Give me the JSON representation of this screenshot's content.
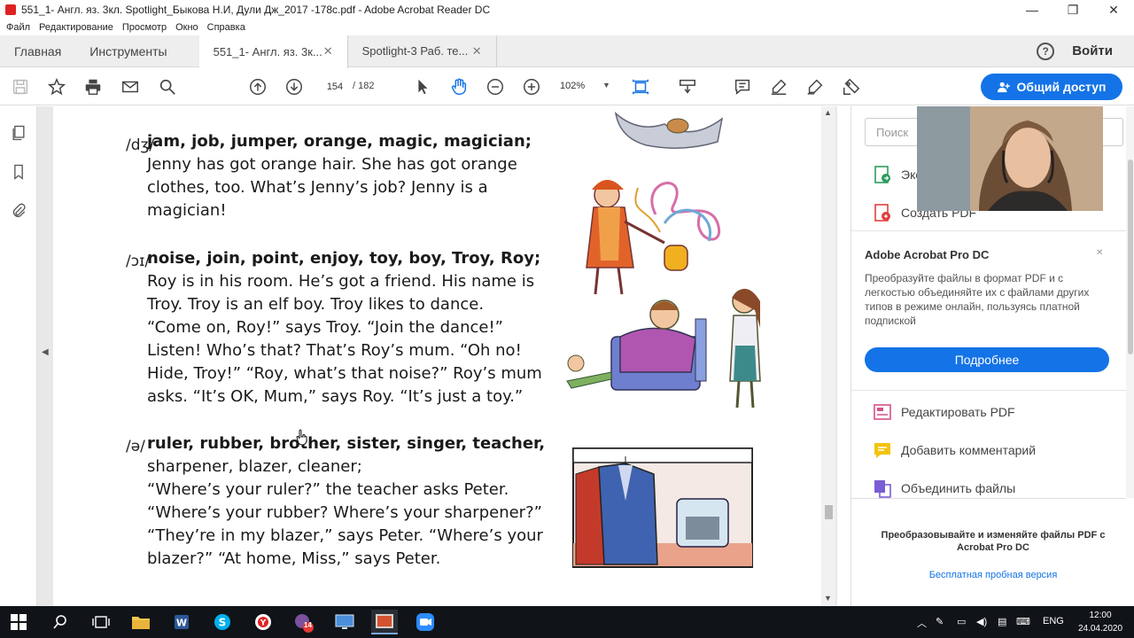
{
  "window": {
    "title": "551_1- Англ. яз. 3кл. Spotlight_Быкова Н.И, Дули Дж_2017 -178с.pdf - Adobe Acrobat Reader DC",
    "minimize": "—",
    "restore": "❐",
    "close": "✕"
  },
  "menu": [
    "Файл",
    "Редактирование",
    "Просмотр",
    "Окно",
    "Справка"
  ],
  "tabs": {
    "home": "Главная",
    "tools": "Инструменты",
    "doc1": "551_1- Англ. яз. 3к...",
    "doc2": "Spotlight-3 Раб. те...",
    "close_glyph": "✕",
    "help": "?",
    "signin": "Войти"
  },
  "toolbar": {
    "page_current": "154",
    "page_total": "/  182",
    "zoom": "102%",
    "share_label": "Общий доступ"
  },
  "document": {
    "sections": [
      {
        "pron": "/dʒ/",
        "words": "jam, job, jumper, orange, magic, magician;",
        "lines": [
          "Jenny has got orange hair. She has got orange",
          "clothes, too. What’s Jenny’s job? Jenny is a",
          "magician!"
        ]
      },
      {
        "pron": "/ɔɪ/",
        "words": "noise, join, point, enjoy, toy, boy, Troy, Roy;",
        "lines": [
          "Roy is in his room. He’s got a friend. His name is",
          "Troy. Troy is an elf boy. Troy likes to dance.",
          "“Come on, Roy!” says Troy. “Join the dance!”",
          "Listen! Who’s that? That’s Roy’s mum. “Oh no!",
          "Hide, Troy!” “Roy, what’s that noise?” Roy’s mum",
          "asks. “It’s OK, Mum,” says Roy. “It’s just a toy.”"
        ]
      },
      {
        "pron": "/ə/",
        "words": "ruler, rubber, brother, sister, singer, teacher,",
        "lines": [
          "sharpener, blazer, cleaner;",
          "“Where’s your ruler?” the teacher asks Peter.",
          "“Where’s your rubber? Where’s your sharpener?”",
          "“They’re in my blazer,” says Peter. “Where’s your",
          "blazer?” “At home, Miss,” says Peter."
        ]
      }
    ]
  },
  "right_panel": {
    "search_placeholder": "Поиск",
    "export_pdf": "Экспорт PDF",
    "create_pdf": "Создать PDF",
    "promo_title": "Adobe Acrobat Pro DC",
    "promo_text": "Преобразуйте файлы в формат PDF и с легкостью объединяйте их с файлами других типов в режиме онлайн, пользуясь платной подпиской",
    "promo_button": "Подробнее",
    "edit_pdf": "Редактировать PDF",
    "add_comment": "Добавить комментарий",
    "combine_files": "Объединить файлы",
    "bottom_title": "Преобразовывайте и изменяйте файлы PDF с Acrobat Pro DC",
    "bottom_link": "Бесплатная пробная версия",
    "close_glyph": "✕"
  },
  "taskbar": {
    "badge": "14",
    "lang": "ENG",
    "time": "12:00",
    "date": "24.04.2020"
  }
}
